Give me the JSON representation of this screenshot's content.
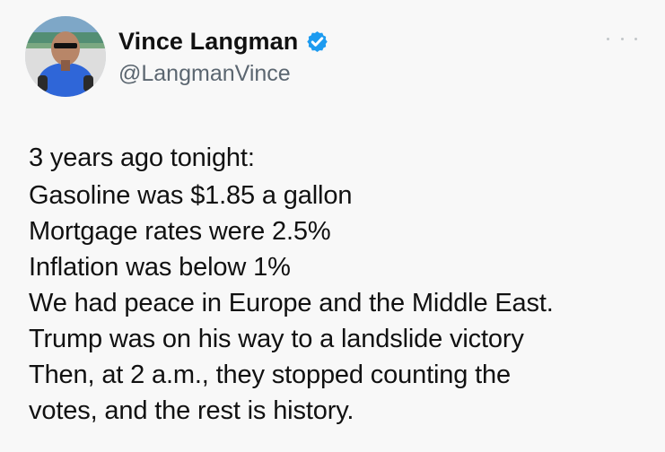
{
  "tweet": {
    "author": {
      "display_name": "Vince Langman",
      "handle": "@LangmanVince",
      "verified": true
    },
    "lines": [
      "3 years ago tonight:",
      "Gasoline was $1.85 a gallon",
      "Mortgage rates were 2.5%",
      "Inflation was below 1%",
      "We had peace in Europe and the Middle East.",
      "Trump was on his way to a landslide victory",
      "Then, at 2 a.m., they stopped counting the",
      "votes, and the rest is history."
    ]
  },
  "icons": {
    "verified": "verified-badge-icon",
    "more": "more-options-icon"
  },
  "colors": {
    "background": "#f8f8f8",
    "text": "#111111",
    "secondary_text": "#5b6670",
    "verified_blue": "#1d9bf0"
  }
}
